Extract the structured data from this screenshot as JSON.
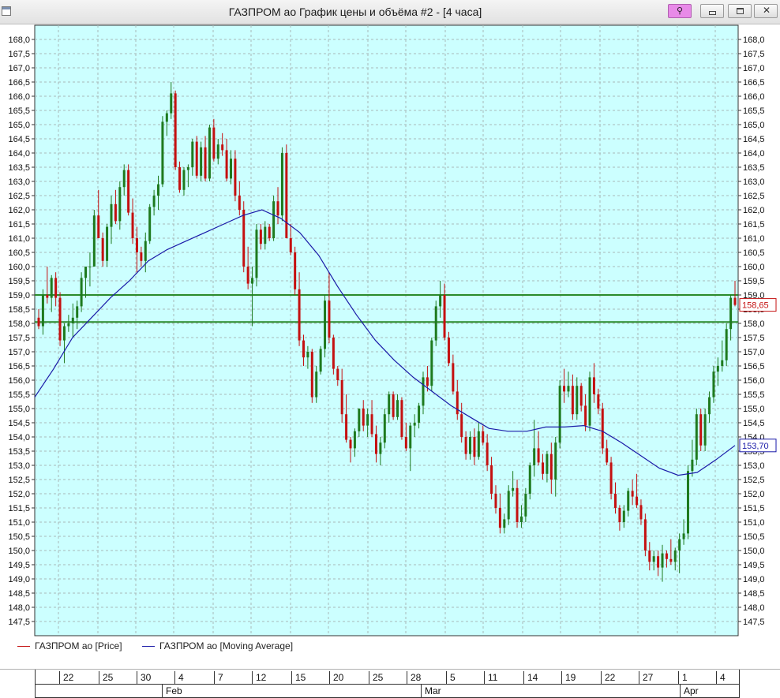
{
  "window": {
    "title": "ГАЗПРОМ ао График цены и объёма #2 - [4 часа]",
    "pin_icon": "pin-icon",
    "close_glyph": "✕"
  },
  "colors": {
    "background": "#ccffff",
    "up": "#1e7a1e",
    "down": "#c41010",
    "ma": "#1a1aa8",
    "hline": "#2a8a2a",
    "grid": "#a8b8b8"
  },
  "legend": {
    "price": "ГАЗПРОМ ао [Price]",
    "ma": "ГАЗПРОМ ао [Moving Average]"
  },
  "time_axis": {
    "days": [
      "22",
      "25",
      "30",
      "4",
      "7",
      "12",
      "15",
      "20",
      "25",
      "28",
      "5",
      "11",
      "14",
      "19",
      "22",
      "27",
      "1",
      "4"
    ],
    "months": [
      "Feb",
      "Mar",
      "Apr"
    ]
  },
  "chart_data": {
    "type": "candlestick",
    "title": "",
    "ylim": [
      147.0,
      168.5
    ],
    "y_ticks": [
      "168,0",
      "167,5",
      "167,0",
      "166,5",
      "166,0",
      "165,5",
      "165,0",
      "164,5",
      "164,0",
      "163,5",
      "163,0",
      "162,5",
      "162,0",
      "161,5",
      "161,0",
      "160,5",
      "160,0",
      "159,5",
      "159,0",
      "158,5",
      "158,0",
      "157,5",
      "157,0",
      "156,5",
      "156,0",
      "155,5",
      "155,0",
      "154,5",
      "154,0",
      "153,5",
      "153,0",
      "152,5",
      "152,0",
      "151,5",
      "151,0",
      "150,5",
      "150,0",
      "149,5",
      "149,0",
      "148,5",
      "148,0",
      "147,5"
    ],
    "grid": true,
    "horizontal_lines": [
      159.0,
      158.05
    ],
    "last_price_label": "158,65",
    "last_ma_label": "153,70",
    "candles": [
      [
        158.2,
        158.5,
        157.8,
        157.9
      ],
      [
        157.9,
        159.2,
        157.6,
        159.0
      ],
      [
        159.0,
        160.0,
        158.7,
        158.9
      ],
      [
        158.9,
        159.7,
        158.4,
        159.6
      ],
      [
        159.6,
        159.8,
        158.6,
        158.9
      ],
      [
        158.9,
        159.1,
        157.2,
        157.4
      ],
      [
        157.4,
        158.0,
        156.6,
        157.9
      ],
      [
        157.9,
        158.3,
        157.7,
        158.0
      ],
      [
        158.0,
        158.7,
        157.5,
        158.2
      ],
      [
        158.2,
        158.8,
        157.8,
        158.6
      ],
      [
        158.6,
        159.8,
        158.4,
        159.6
      ],
      [
        159.6,
        160.0,
        158.9,
        160.0
      ],
      [
        160.0,
        160.5,
        159.3,
        160.0
      ],
      [
        160.0,
        162.0,
        160.0,
        161.8
      ],
      [
        161.8,
        162.7,
        161.1,
        161.0
      ],
      [
        161.0,
        161.2,
        160.0,
        160.2
      ],
      [
        160.2,
        161.5,
        160.0,
        161.4
      ],
      [
        161.4,
        162.5,
        160.8,
        162.2
      ],
      [
        162.2,
        162.7,
        161.5,
        161.6
      ],
      [
        161.6,
        163.0,
        161.3,
        162.8
      ],
      [
        162.8,
        163.6,
        162.5,
        163.4
      ],
      [
        163.4,
        163.6,
        161.8,
        161.9
      ],
      [
        161.9,
        162.4,
        160.8,
        161.0
      ],
      [
        161.0,
        161.4,
        159.8,
        160.5
      ],
      [
        160.5,
        160.7,
        160.0,
        160.2
      ],
      [
        160.2,
        161.2,
        159.8,
        160.9
      ],
      [
        160.9,
        162.2,
        160.8,
        162.1
      ],
      [
        162.1,
        162.7,
        161.8,
        162.5
      ],
      [
        162.5,
        163.2,
        162.0,
        162.9
      ],
      [
        162.9,
        165.3,
        162.8,
        165.1
      ],
      [
        165.1,
        165.5,
        164.6,
        165.4
      ],
      [
        165.4,
        166.5,
        165.2,
        166.1
      ],
      [
        166.1,
        166.2,
        163.4,
        163.5
      ],
      [
        163.5,
        163.7,
        162.6,
        162.7
      ],
      [
        162.7,
        163.5,
        162.5,
        163.4
      ],
      [
        163.4,
        163.6,
        162.8,
        163.5
      ],
      [
        163.5,
        164.5,
        163.2,
        164.4
      ],
      [
        164.4,
        164.6,
        163.1,
        163.2
      ],
      [
        163.2,
        164.4,
        163.0,
        164.2
      ],
      [
        164.2,
        164.6,
        163.0,
        163.1
      ],
      [
        163.1,
        165.0,
        163.0,
        164.9
      ],
      [
        164.9,
        165.2,
        163.7,
        163.8
      ],
      [
        163.8,
        164.5,
        163.6,
        164.3
      ],
      [
        164.3,
        164.7,
        163.9,
        164.1
      ],
      [
        164.1,
        164.5,
        163.0,
        163.1
      ],
      [
        163.1,
        164.1,
        162.9,
        163.8
      ],
      [
        163.8,
        164.1,
        162.3,
        162.5
      ],
      [
        162.5,
        163.0,
        161.8,
        162.0
      ],
      [
        162.0,
        162.3,
        159.8,
        160.0
      ],
      [
        160.0,
        160.7,
        159.2,
        159.4
      ],
      [
        159.4,
        160.0,
        157.9,
        159.6
      ],
      [
        159.6,
        161.5,
        159.3,
        161.3
      ],
      [
        161.3,
        161.5,
        160.6,
        160.8
      ],
      [
        160.8,
        161.6,
        160.6,
        161.4
      ],
      [
        161.4,
        161.5,
        160.9,
        161.0
      ],
      [
        161.0,
        162.5,
        160.9,
        162.3
      ],
      [
        162.3,
        162.8,
        161.5,
        161.8
      ],
      [
        161.8,
        164.2,
        161.6,
        164.0
      ],
      [
        164.0,
        164.3,
        161.9,
        161.0
      ],
      [
        161.0,
        161.5,
        160.4,
        160.5
      ],
      [
        160.5,
        160.7,
        159.0,
        159.2
      ],
      [
        159.2,
        159.8,
        157.2,
        157.4
      ],
      [
        157.4,
        157.6,
        156.5,
        156.8
      ],
      [
        156.8,
        157.2,
        156.4,
        157.0
      ],
      [
        157.0,
        157.1,
        155.2,
        155.4
      ],
      [
        155.4,
        156.5,
        155.2,
        156.3
      ],
      [
        156.3,
        157.2,
        156.2,
        157.1
      ],
      [
        157.1,
        159.0,
        156.8,
        158.8
      ],
      [
        158.8,
        159.8,
        157.3,
        157.5
      ],
      [
        157.5,
        157.6,
        156.2,
        156.4
      ],
      [
        156.4,
        156.5,
        155.8,
        156.0
      ],
      [
        156.0,
        156.4,
        154.5,
        154.8
      ],
      [
        154.8,
        155.5,
        153.8,
        153.9
      ],
      [
        153.9,
        154.0,
        153.1,
        153.6
      ],
      [
        153.6,
        154.3,
        153.3,
        154.2
      ],
      [
        154.2,
        155.0,
        154.0,
        155.0
      ],
      [
        155.0,
        155.3,
        154.2,
        154.4
      ],
      [
        154.4,
        155.0,
        154.0,
        154.8
      ],
      [
        154.8,
        155.3,
        154.0,
        154.1
      ],
      [
        154.1,
        154.4,
        153.1,
        153.4
      ],
      [
        153.4,
        154.0,
        153.0,
        153.8
      ],
      [
        153.8,
        155.0,
        153.6,
        154.8
      ],
      [
        154.8,
        155.6,
        154.5,
        155.5
      ],
      [
        155.5,
        155.6,
        154.6,
        154.7
      ],
      [
        154.7,
        155.5,
        154.6,
        155.3
      ],
      [
        155.3,
        155.4,
        153.9,
        154.0
      ],
      [
        154.0,
        154.5,
        153.5,
        153.6
      ],
      [
        153.6,
        154.5,
        152.8,
        154.4
      ],
      [
        154.4,
        154.8,
        154.0,
        154.5
      ],
      [
        154.5,
        155.2,
        154.3,
        155.1
      ],
      [
        155.1,
        156.3,
        154.8,
        156.1
      ],
      [
        156.1,
        156.5,
        155.6,
        155.8
      ],
      [
        155.8,
        157.5,
        155.6,
        157.4
      ],
      [
        157.4,
        158.8,
        157.2,
        158.6
      ],
      [
        158.6,
        159.5,
        158.2,
        159.0
      ],
      [
        159.0,
        159.4,
        157.4,
        157.5
      ],
      [
        157.5,
        157.7,
        156.5,
        156.6
      ],
      [
        156.6,
        156.9,
        155.5,
        155.6
      ],
      [
        155.6,
        156.0,
        154.6,
        154.8
      ],
      [
        154.8,
        155.2,
        153.8,
        154.0
      ],
      [
        154.0,
        154.2,
        153.2,
        153.4
      ],
      [
        153.4,
        154.2,
        153.2,
        154.0
      ],
      [
        154.0,
        154.3,
        153.0,
        153.3
      ],
      [
        153.3,
        154.5,
        153.2,
        154.2
      ],
      [
        154.2,
        154.4,
        153.7,
        153.8
      ],
      [
        153.8,
        154.1,
        152.8,
        153.0
      ],
      [
        153.0,
        153.3,
        151.8,
        152.0
      ],
      [
        152.0,
        152.3,
        151.3,
        151.5
      ],
      [
        151.5,
        152.0,
        150.6,
        150.8
      ],
      [
        150.8,
        151.3,
        150.6,
        151.1
      ],
      [
        151.1,
        152.3,
        150.9,
        152.1
      ],
      [
        152.1,
        152.8,
        151.9,
        152.2
      ],
      [
        152.2,
        152.5,
        150.8,
        151.0
      ],
      [
        151.0,
        151.6,
        150.8,
        151.2
      ],
      [
        151.2,
        152.2,
        151.0,
        152.0
      ],
      [
        152.0,
        153.1,
        151.8,
        153.0
      ],
      [
        153.0,
        154.6,
        152.6,
        153.6
      ],
      [
        153.6,
        154.2,
        153.0,
        153.1
      ],
      [
        153.1,
        153.4,
        152.5,
        152.7
      ],
      [
        152.7,
        153.5,
        152.4,
        153.4
      ],
      [
        153.4,
        153.8,
        152.0,
        152.5
      ],
      [
        152.5,
        154.0,
        151.9,
        153.8
      ],
      [
        153.8,
        156.0,
        153.6,
        155.8
      ],
      [
        155.8,
        156.4,
        155.2,
        155.6
      ],
      [
        155.6,
        156.3,
        155.4,
        155.8
      ],
      [
        155.8,
        156.2,
        154.6,
        154.8
      ],
      [
        154.8,
        156.1,
        154.6,
        155.8
      ],
      [
        155.8,
        155.9,
        154.9,
        155.1
      ],
      [
        155.1,
        155.5,
        154.2,
        154.4
      ],
      [
        154.4,
        156.3,
        154.2,
        156.1
      ],
      [
        156.1,
        156.6,
        155.2,
        155.5
      ],
      [
        155.5,
        155.7,
        154.8,
        155.0
      ],
      [
        155.0,
        155.2,
        153.4,
        153.6
      ],
      [
        153.6,
        153.9,
        153.0,
        153.1
      ],
      [
        153.1,
        153.3,
        151.8,
        152.0
      ],
      [
        152.0,
        152.4,
        151.3,
        151.5
      ],
      [
        151.5,
        151.6,
        150.7,
        151.0
      ],
      [
        151.0,
        151.6,
        150.8,
        151.4
      ],
      [
        151.4,
        152.2,
        151.2,
        152.1
      ],
      [
        152.1,
        152.5,
        151.6,
        151.9
      ],
      [
        151.9,
        152.7,
        151.5,
        151.6
      ],
      [
        151.6,
        151.8,
        150.9,
        151.1
      ],
      [
        151.1,
        151.3,
        149.8,
        150.0
      ],
      [
        150.0,
        150.3,
        149.3,
        149.6
      ],
      [
        149.6,
        150.0,
        149.3,
        149.8
      ],
      [
        149.8,
        150.0,
        149.1,
        149.4
      ],
      [
        149.4,
        150.2,
        148.9,
        149.9
      ],
      [
        149.9,
        150.0,
        149.4,
        149.7
      ],
      [
        149.7,
        150.4,
        149.5,
        149.6
      ],
      [
        149.6,
        150.1,
        149.3,
        150.0
      ],
      [
        150.0,
        150.6,
        149.2,
        150.4
      ],
      [
        150.4,
        151.1,
        150.2,
        150.6
      ],
      [
        150.6,
        153.0,
        150.4,
        152.8
      ],
      [
        152.8,
        153.9,
        152.6,
        153.2
      ],
      [
        153.2,
        155.0,
        153.0,
        154.8
      ],
      [
        154.8,
        155.0,
        153.5,
        153.7
      ],
      [
        153.7,
        155.0,
        153.5,
        154.8
      ],
      [
        154.8,
        155.6,
        154.5,
        155.4
      ],
      [
        155.4,
        156.5,
        155.2,
        156.3
      ],
      [
        156.3,
        156.8,
        155.8,
        156.5
      ],
      [
        156.5,
        157.4,
        156.3,
        156.7
      ],
      [
        156.7,
        158.0,
        156.5,
        157.8
      ],
      [
        157.8,
        159.0,
        157.4,
        158.9
      ],
      [
        158.9,
        159.5,
        158.6,
        158.65
      ]
    ],
    "moving_average": [
      155.4,
      156.4,
      157.5,
      158.2,
      158.9,
      159.5,
      160.2,
      160.6,
      160.9,
      161.2,
      161.5,
      161.8,
      162.0,
      161.7,
      161.2,
      160.4,
      159.3,
      158.3,
      157.4,
      156.7,
      156.1,
      155.6,
      155.1,
      154.7,
      154.3,
      154.2,
      154.2,
      154.35,
      154.35,
      154.4,
      154.2,
      153.8,
      153.35,
      152.9,
      152.65,
      152.75,
      153.2,
      153.7
    ],
    "x_labels": [
      "22",
      "25",
      "30",
      "4",
      "7",
      "12",
      "15",
      "20",
      "25",
      "28",
      "5",
      "11",
      "14",
      "19",
      "22",
      "27",
      "1",
      "4"
    ],
    "x_months": [
      "Feb",
      "Mar",
      "Apr"
    ]
  }
}
